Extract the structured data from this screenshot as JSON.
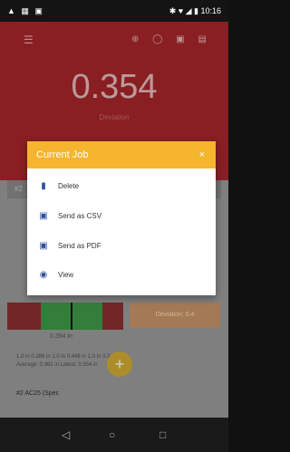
{
  "status_bar": {
    "left_icons": "▲ ▦ ▣",
    "right_icons": "✱ ♥ ◢ ▮",
    "time": "10:16"
  },
  "header": {
    "value": "0.354",
    "value_label": "Deviation",
    "menu_icon": "menu-icon"
  },
  "dialog": {
    "title": "Current Job",
    "items": [
      {
        "label": "Delete",
        "icon": "trash-icon"
      },
      {
        "label": "Send as CSV",
        "icon": "csv-icon"
      },
      {
        "label": "Send as PDF",
        "icon": "pdf-icon"
      },
      {
        "label": "View",
        "icon": "eye-icon"
      }
    ]
  },
  "background": {
    "gauge_value": "0.354 in",
    "orange_label": "Deviation: 0.4",
    "stats_line1": "1.0 in 0.286 in  1.0 in 0.446 in  1.0 in 0.346 in",
    "stats_line2": "Average: 0.362 in         Latest: 0.354 in",
    "row2": "#2 AC25 (Spec"
  },
  "nav": {
    "back": "◁",
    "home": "○",
    "recent": "□"
  }
}
